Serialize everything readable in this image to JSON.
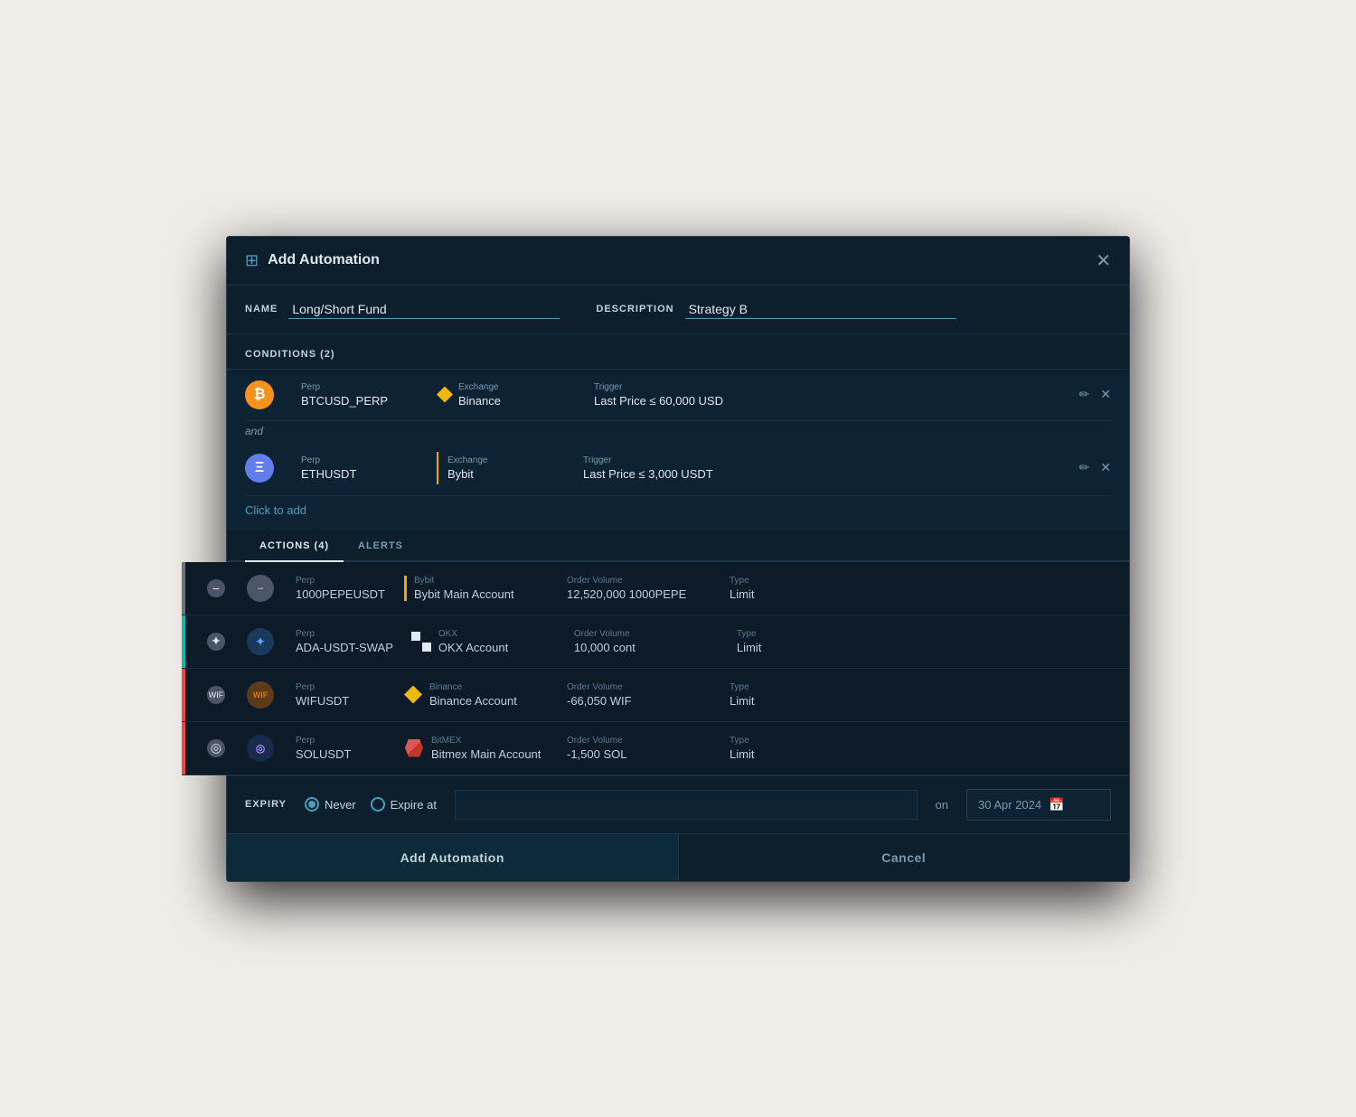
{
  "modal": {
    "title": "Add Automation",
    "icon": "⊞",
    "close_label": "✕"
  },
  "name_field": {
    "label": "NAME",
    "value": "Long/Short Fund",
    "placeholder": "Long/Short Fund"
  },
  "desc_field": {
    "label": "DESCRIPTION",
    "value": "Strategy B",
    "placeholder": "Strategy B"
  },
  "conditions": {
    "title": "CONDITIONS (2)",
    "items": [
      {
        "coin_label": "B",
        "coin_type": "btc",
        "perp_label": "Perp",
        "perp_value": "BTCUSD_PERP",
        "exchange_label": "Exchange",
        "exchange_value": "Binance",
        "exchange_type": "binance",
        "trigger_label": "Trigger",
        "trigger_value": "Last Price ≤ 60,000 USD"
      },
      {
        "coin_label": "Ξ",
        "coin_type": "eth",
        "perp_label": "Perp",
        "perp_value": "ETHUSDT",
        "exchange_label": "Exchange",
        "exchange_value": "Bybit",
        "exchange_type": "bybit",
        "trigger_label": "Trigger",
        "trigger_value": "Last Price ≤ 3,000 USDT"
      }
    ],
    "and_label": "and",
    "click_to_add": "Click to add"
  },
  "tabs": [
    {
      "label": "ACTIONS (4)",
      "active": true
    },
    {
      "label": "ALERTS",
      "active": false
    }
  ],
  "actions": [
    {
      "border_color": "gray",
      "coin_label": "—",
      "coin_type": "pepe",
      "perp_label": "Perp",
      "perp_value": "1000PEPEUSDT",
      "exchange_label": "Bybit",
      "exchange_account": "Bybit Main Account",
      "exchange_type": "bybit",
      "volume_label": "Order Volume",
      "volume_value": "12,520,000 1000PEPE",
      "type_label": "Type",
      "type_value": "Limit"
    },
    {
      "border_color": "teal",
      "coin_label": "✦",
      "coin_type": "ada",
      "perp_label": "Perp",
      "perp_value": "ADA-USDT-SWAP",
      "exchange_label": "OKX",
      "exchange_account": "OKX Account",
      "exchange_type": "okx",
      "volume_label": "Order Volume",
      "volume_value": "10,000 cont",
      "type_label": "Type",
      "type_value": "Limit"
    },
    {
      "border_color": "red",
      "coin_label": "WIF",
      "coin_type": "wif",
      "perp_label": "Perp",
      "perp_value": "WIFUSDT",
      "exchange_label": "Binance",
      "exchange_account": "Binance Account",
      "exchange_type": "binance",
      "volume_label": "Order Volume",
      "volume_value": "-66,050 WIF",
      "type_label": "Type",
      "type_value": "Limit"
    },
    {
      "border_color": "red2",
      "coin_label": "◎",
      "coin_type": "sol",
      "perp_label": "Perp",
      "perp_value": "SOLUSDT",
      "exchange_label": "BitMEX",
      "exchange_account": "Bitmex Main Account",
      "exchange_type": "bitmex",
      "volume_label": "Order Volume",
      "volume_value": "-1,500 SOL",
      "type_label": "Type",
      "type_value": "Limit"
    }
  ],
  "expiry": {
    "label": "EXPIRY",
    "never_label": "Never",
    "expire_at_label": "Expire at",
    "never_selected": true,
    "on_label": "on",
    "date_value": "30 Apr 2024",
    "date_placeholder": "30 Apr 2024"
  },
  "footer": {
    "primary_label": "Add Automation",
    "secondary_label": "Cancel"
  }
}
